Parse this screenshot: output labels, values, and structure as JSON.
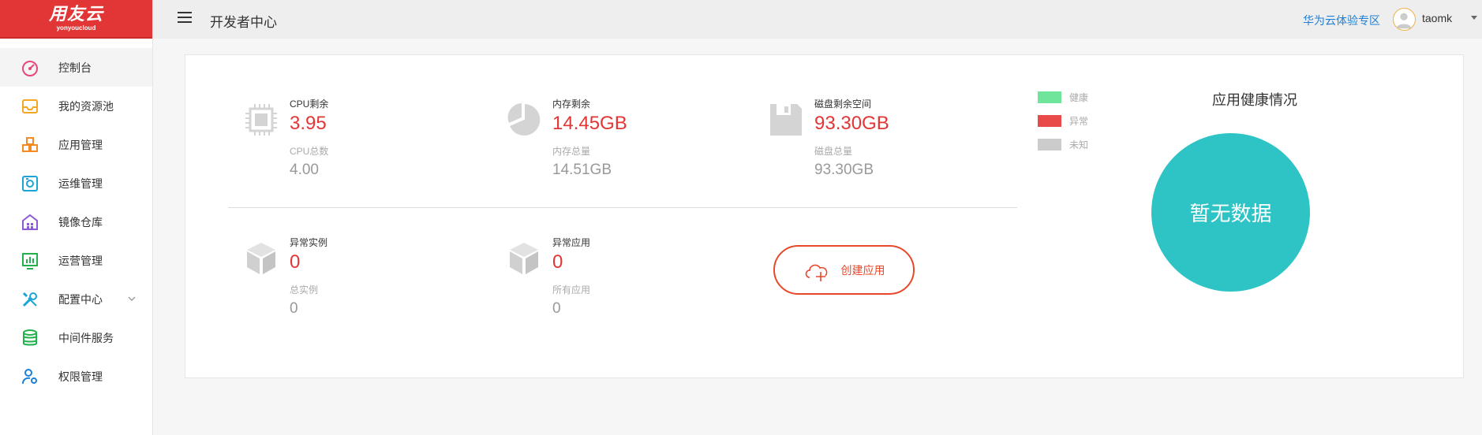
{
  "brand": {
    "logo_main": "用友云",
    "logo_sub": "yonyoucloud",
    "color": "#e23535"
  },
  "header": {
    "title": "开发者中心",
    "zone_link": "华为云体验专区",
    "username": "taomk",
    "link_color": "#1e7fd6"
  },
  "sidebar": {
    "items": [
      {
        "label": "控制台",
        "icon": "dashboard-icon",
        "active": true
      },
      {
        "label": "我的资源池",
        "icon": "inbox-icon"
      },
      {
        "label": "应用管理",
        "icon": "boxes-icon"
      },
      {
        "label": "运维管理",
        "icon": "monitor-icon"
      },
      {
        "label": "镜像仓库",
        "icon": "warehouse-icon"
      },
      {
        "label": "运营管理",
        "icon": "chart-icon"
      },
      {
        "label": "配置中心",
        "icon": "tools-icon",
        "has_submenu": true
      },
      {
        "label": "中间件服务",
        "icon": "database-icon"
      },
      {
        "label": "权限管理",
        "icon": "user-gear-icon"
      }
    ]
  },
  "resources": {
    "cpu": {
      "label": "CPU剩余",
      "value": "3.95",
      "sub_label": "CPU总数",
      "sub_value": "4.00",
      "icon": "cpu-icon"
    },
    "memory": {
      "label": "内存剩余",
      "value": "14.45GB",
      "sub_label": "内存总量",
      "sub_value": "14.51GB",
      "icon": "pie-icon"
    },
    "disk": {
      "label": "磁盘剩余空间",
      "value": "93.30GB",
      "sub_label": "磁盘总量",
      "sub_value": "93.30GB",
      "icon": "floppy-icon"
    }
  },
  "instances": {
    "abnormal_instances": {
      "label": "异常实例",
      "value": "0",
      "sub_label": "总实例",
      "sub_value": "0",
      "icon": "cube-icon"
    },
    "abnormal_apps": {
      "label": "异常应用",
      "value": "0",
      "sub_label": "所有应用",
      "sub_value": "0",
      "icon": "cube-icon"
    }
  },
  "create_app_label": "创建应用",
  "legend": [
    {
      "label": "健康",
      "color": "#6ee59a"
    },
    {
      "label": "异常",
      "color": "#e84a4a"
    },
    {
      "label": "未知",
      "color": "#cccccc"
    }
  ],
  "health": {
    "title": "应用健康情况",
    "empty_text": "暂无数据",
    "color": "#2ec4c6"
  },
  "accent_color": "#e23535"
}
